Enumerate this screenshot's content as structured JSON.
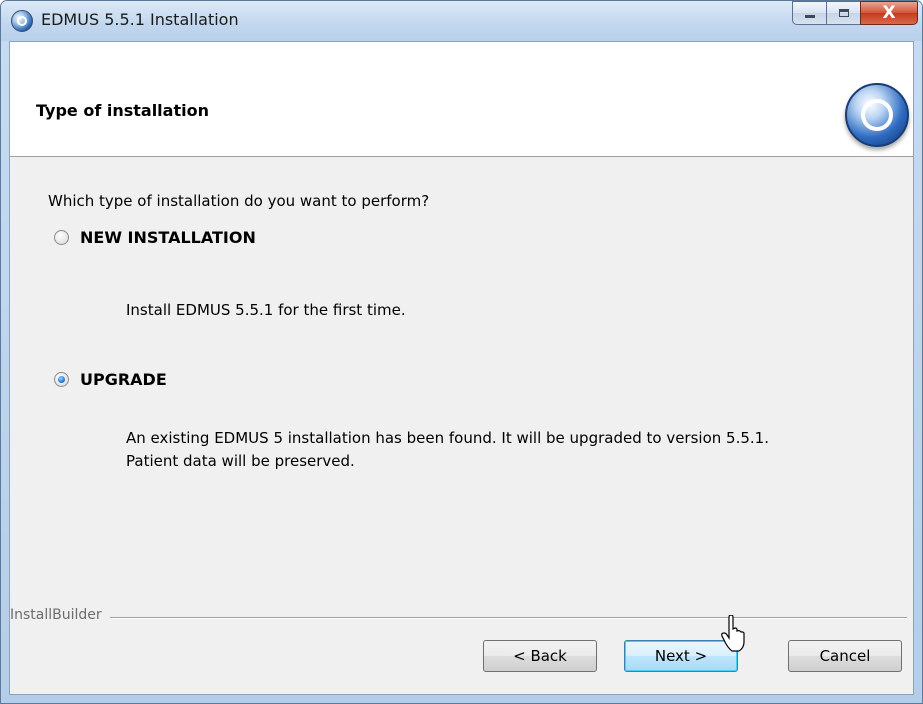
{
  "window": {
    "title": "EDMUS 5.5.1 Installation",
    "caption_buttons": {
      "minimize": "minimize-icon",
      "maximize": "maximize-icon",
      "close": "X"
    }
  },
  "header": {
    "title": "Type of installation",
    "logo_icon": "edmus-logo-icon"
  },
  "question": "Which type of installation do you want to perform?",
  "options": [
    {
      "label": "NEW INSTALLATION",
      "checked": false,
      "description": [
        "Install EDMUS 5.5.1 for the first time."
      ]
    },
    {
      "label": "UPGRADE",
      "checked": true,
      "description": [
        "An existing EDMUS 5 installation has been found. It will be upgraded to version 5.5.1.",
        "Patient data will be preserved."
      ]
    }
  ],
  "footer": {
    "brand": "InstallBuilder",
    "back_label": "< Back",
    "next_label": "Next >",
    "cancel_label": "Cancel"
  },
  "colors": {
    "selected_radio": "#2c7fd6",
    "close_button": "#c43a1d",
    "default_button_border": "#3c7fb1"
  }
}
